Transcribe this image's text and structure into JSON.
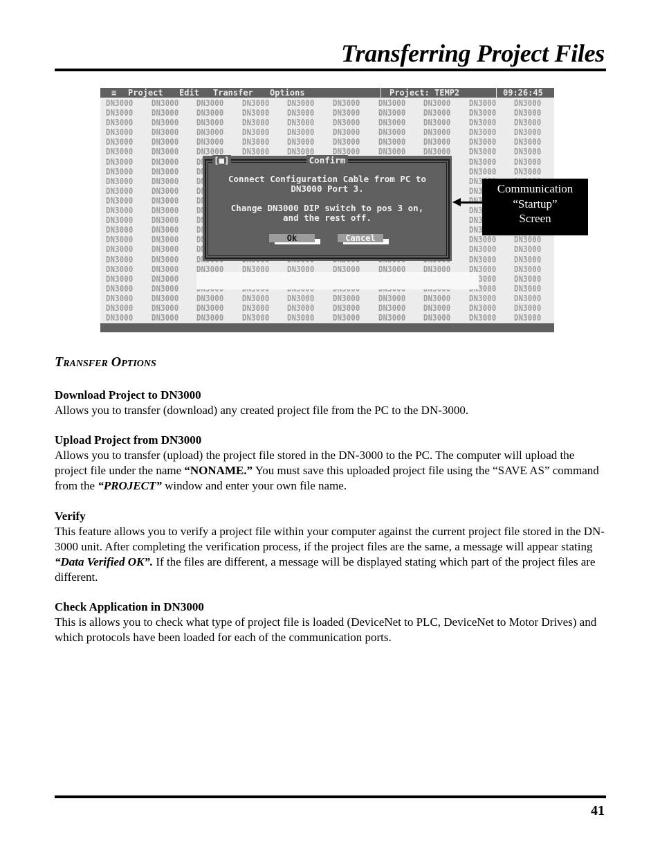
{
  "header": {
    "title": "Transferring Project Files"
  },
  "screenshot": {
    "menu": {
      "system_icon": "≡",
      "items": [
        "Project",
        "Edit",
        "Transfer",
        "Options"
      ],
      "project_label": "Project: TEMP2",
      "clock": "09:26:45"
    },
    "grid": {
      "cell_text": "DN3000",
      "columns": 10,
      "rows": 23
    },
    "dialog": {
      "close_glyph": "[■]",
      "title": "Confirm",
      "message_1": "Connect Configuration Cable from PC to\nDN3000 Port 3.",
      "message_2": "Change DN3000 DIP switch to pos 3 on,\nand the rest off.",
      "buttons": {
        "ok": "Ok",
        "cancel": "Cancel"
      }
    }
  },
  "callout": {
    "lines": [
      "Communication",
      "“Startup”",
      "Screen"
    ]
  },
  "section": {
    "heading": "Transfer Options",
    "items": [
      {
        "title": "Download Project to DN3000",
        "body": "Allows you to transfer (download) any created project file from the PC to the DN-3000."
      },
      {
        "title": "Upload Project from DN3000",
        "body_parts": [
          "Allows you to transfer (upload) the project file stored in the DN-3000 to the PC.  The computer will upload the project file under the name ",
          "“NONAME.”",
          "  You must save this uploaded project file using the “SAVE AS” command from the ",
          "“PROJECT”",
          " window and enter your own file name."
        ]
      },
      {
        "title": "Verify",
        "body_parts": [
          "This feature allows you to verify a project file within your computer against the current project file stored in the DN-3000 unit.  After completing the verification process, if the project files are the same, a message will appear stating  ",
          "“Data Verified OK”.",
          "   If the files are different, a message will be displayed stating which part of the project files are different."
        ]
      },
      {
        "title": "Check Application in DN3000",
        "body": "This is allows you to check what type of project file is loaded (DeviceNet to PLC, DeviceNet to Motor Drives) and which protocols have been loaded for each of the communication ports."
      }
    ]
  },
  "footer": {
    "page_number": "41"
  }
}
